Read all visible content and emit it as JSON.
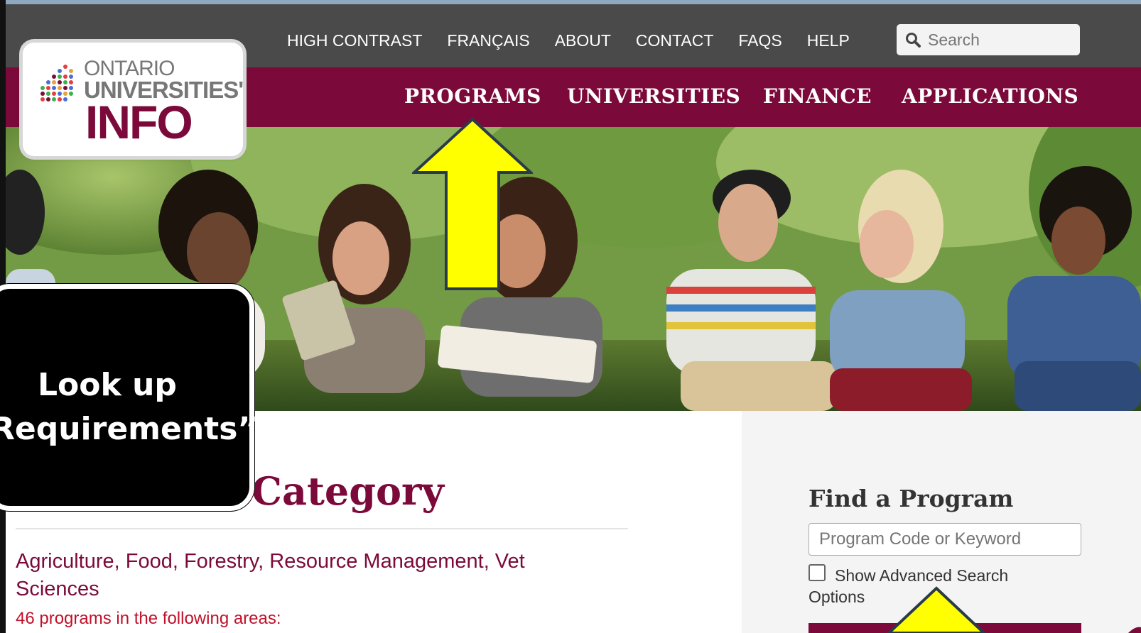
{
  "utility_nav": {
    "items": [
      "HIGH CONTRAST",
      "FRANÇAIS",
      "ABOUT",
      "CONTACT",
      "FAQS",
      "HELP"
    ]
  },
  "search": {
    "placeholder": "Search",
    "icon": "search-icon"
  },
  "logo": {
    "line1": "ONTARIO",
    "line2": "UNIVERSITIES'",
    "line3": "INFO"
  },
  "main_nav": {
    "items": [
      "PROGRAMS",
      "UNIVERSITIES",
      "FINANCE",
      "APPLICATIONS"
    ]
  },
  "callout": {
    "line1": "Look up",
    "line2": "Requirements”"
  },
  "content": {
    "heading": "Category",
    "category_title": "Agriculture, Food, Forestry, Resource Management, Vet Sciences",
    "category_count": "46 programs in the following areas:"
  },
  "find_program": {
    "title": "Find a Program",
    "input_placeholder": "Program Code or Keyword",
    "advanced_label": "Show Advanced Search Options"
  },
  "colors": {
    "brand": "#7b0a3a",
    "topbar": "#4a4a4a",
    "arrow": "#ffff00"
  }
}
